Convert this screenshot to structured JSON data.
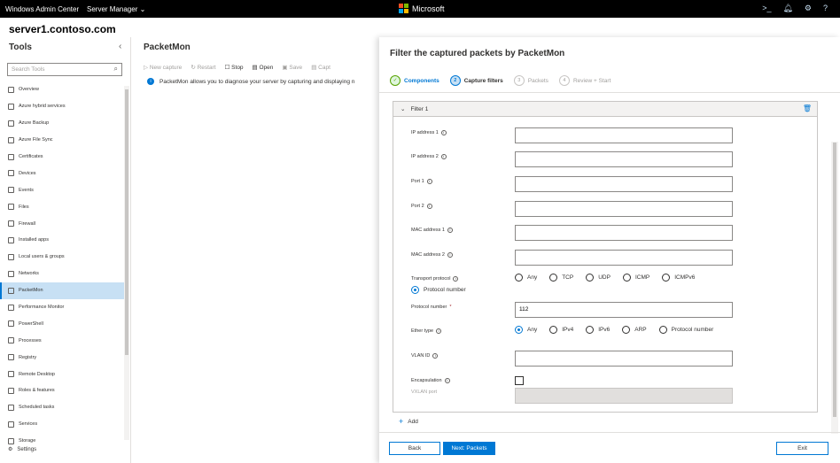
{
  "topbar": {
    "brand": "Windows Admin Center",
    "server_manager": "Server Manager",
    "microsoft": "Microsoft"
  },
  "server": "server1.contoso.com",
  "tools": {
    "title": "Tools",
    "search_placeholder": "Search Tools",
    "items": [
      {
        "label": "Overview",
        "icon": "overview-icon"
      },
      {
        "label": "Azure hybrid services",
        "icon": "cloud-icon"
      },
      {
        "label": "Azure Backup",
        "icon": "cloud-icon"
      },
      {
        "label": "Azure File Sync",
        "icon": "cloud-icon"
      },
      {
        "label": "Certificates",
        "icon": "certificate-icon"
      },
      {
        "label": "Devices",
        "icon": "devices-icon"
      },
      {
        "label": "Events",
        "icon": "events-icon"
      },
      {
        "label": "Files",
        "icon": "folder-icon"
      },
      {
        "label": "Firewall",
        "icon": "firewall-icon"
      },
      {
        "label": "Installed apps",
        "icon": "apps-icon"
      },
      {
        "label": "Local users & groups",
        "icon": "users-icon"
      },
      {
        "label": "Networks",
        "icon": "network-icon"
      },
      {
        "label": "PacketMon",
        "icon": "packetmon-icon",
        "active": true
      },
      {
        "label": "Performance Monitor",
        "icon": "performance-icon"
      },
      {
        "label": "PowerShell",
        "icon": "powershell-icon"
      },
      {
        "label": "Processes",
        "icon": "processes-icon"
      },
      {
        "label": "Registry",
        "icon": "registry-icon"
      },
      {
        "label": "Remote Desktop",
        "icon": "remote-desktop-icon"
      },
      {
        "label": "Roles & features",
        "icon": "roles-icon"
      },
      {
        "label": "Scheduled tasks",
        "icon": "tasks-icon"
      },
      {
        "label": "Services",
        "icon": "services-icon"
      },
      {
        "label": "Storage",
        "icon": "storage-icon"
      }
    ],
    "settings": "Settings"
  },
  "main": {
    "title": "PacketMon",
    "toolbar": [
      "New capture",
      "Restart",
      "Stop",
      "Open",
      "Save",
      "Capt"
    ],
    "info": "PacketMon allows you to diagnose your server by capturing and displaying n"
  },
  "panel": {
    "title": "Filter the captured packets by PacketMon",
    "steps": [
      {
        "num": "✓",
        "label": "Components",
        "state": "done"
      },
      {
        "num": "2",
        "label": "Capture filters",
        "state": "current"
      },
      {
        "num": "3",
        "label": "Packets",
        "state": "pending"
      },
      {
        "num": "4",
        "label": "Review + Start",
        "state": "pending"
      }
    ],
    "filter_title": "Filter 1",
    "fields": {
      "ip1": "IP address 1",
      "ip2": "IP address 2",
      "port1": "Port 1",
      "port2": "Port 2",
      "mac1": "MAC address 1",
      "mac2": "MAC address 2",
      "transport": "Transport protocol",
      "protocol_number": "Protocol number",
      "protocol_number_value": "112",
      "ether_type": "Ether type",
      "vlan": "VLAN ID",
      "encapsulation": "Encapsulation",
      "vxlan": "VXLAN port"
    },
    "transport_options": [
      "Any",
      "TCP",
      "UDP",
      "ICMP",
      "ICMPv6"
    ],
    "transport_selected": "Protocol number",
    "ether_options": [
      "Any",
      "IPv4",
      "IPv6",
      "ARP",
      "Protocol number"
    ],
    "add": "Add",
    "buttons": {
      "back": "Back",
      "next": "Next: Packets",
      "exit": "Exit"
    }
  }
}
